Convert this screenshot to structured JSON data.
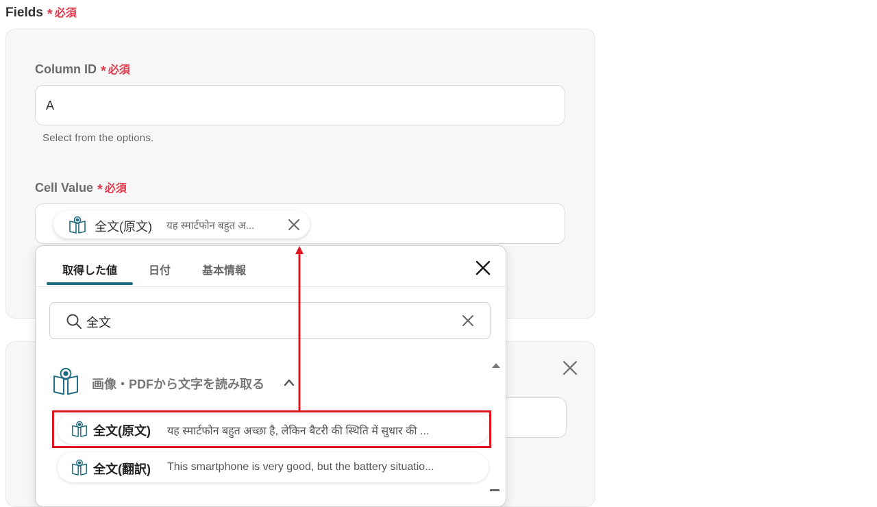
{
  "fields": {
    "title": "Fields",
    "required": "必須"
  },
  "column_id": {
    "label": "Column ID",
    "required": "必須",
    "value": "A",
    "helper": "Select from the options."
  },
  "cell_value": {
    "label": "Cell Value",
    "required": "必須",
    "chip": {
      "name": "全文(原文)",
      "value": "यह स्मार्टफोन बहुत अ..."
    }
  },
  "popup": {
    "tabs": [
      "取得した値",
      "日付",
      "基本情報"
    ],
    "active_tab": "取得した値",
    "search": {
      "value": "全文"
    },
    "group": {
      "label": "画像・PDFから文字を読み取る"
    },
    "options": [
      {
        "name": "全文(原文)",
        "value": "यह स्मार्टफोन बहुत अच्छा है, लेकिन बैटरी की स्थिति में सुधार की ..."
      },
      {
        "name": "全文(翻訳)",
        "value": "This smartphone is very good, but the battery situatio..."
      }
    ]
  },
  "colors": {
    "accent": "#1f6b80",
    "required": "#e23a4c",
    "annotation": "#e0141e",
    "icon": "#1f6b80"
  },
  "icons": [
    "book-eye-icon",
    "close-icon",
    "search-icon",
    "chevron-up-icon",
    "scroll-up-icon"
  ]
}
